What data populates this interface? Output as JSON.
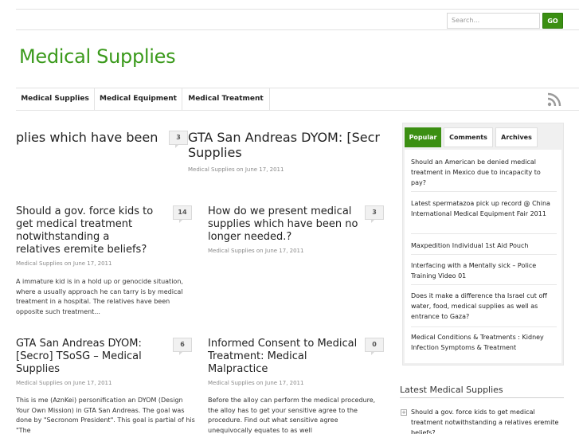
{
  "header": {
    "search_placeholder": "Search...",
    "go_label": "GO",
    "site_title": "Medical Supplies"
  },
  "nav": {
    "items": [
      "Medical Supplies",
      "Medical Equipment",
      "Medical Treatment"
    ],
    "rss_icon": "rss-icon"
  },
  "featured": {
    "left_title": "plies which have been",
    "right_title_line1": "GTA San Andreas DYOM: [Secr",
    "right_title_line2": "Supplies",
    "right_comments": "3",
    "right_meta": "Medical Supplies on June 17, 2011"
  },
  "posts": [
    {
      "title": "Should a gov. force kids to get medical treatment notwithstanding a relatives eremite beliefs?",
      "comments": "14",
      "meta": "Medical Supplies on June 17, 2011",
      "excerpt": "A immature kid is in a hold up or genocide situation, where a usually approach he can tarry is by medical treatment in a hospital. The relatives have been opposite such treatment..."
    },
    {
      "title": "How do we present medical supplies which have been no longer needed.?",
      "comments": "3",
      "meta": "Medical Supplies on June 17, 2011",
      "excerpt": ""
    },
    {
      "title": "GTA San Andreas DYOM: [Secro] TSoSG – Medical Supplies",
      "comments": "6",
      "meta": "Medical Supplies on June 17, 2011",
      "excerpt": "This is me (AznKei) personification an DYOM (Design Your Own Mission) in GTA San Andreas. The goal was done by \"Secronom President\". This goal is partial of his \"The"
    },
    {
      "title": "Informed Consent to Medical Treatment: Medical Malpractice",
      "comments": "0",
      "meta": "Medical Supplies on June 17, 2011",
      "excerpt": "Before the alloy can perform the medical procedure, the alloy has to get your sensitive agree to the procedure. Find out what sensitive agree unequivocally equates to as well"
    }
  ],
  "sidebar": {
    "tabs": [
      "Popular",
      "Comments",
      "Archives"
    ],
    "items": [
      "Should an American be denied medical treatment in Mexico due to incapacity to pay?",
      "Latest spermatazoa pick up record @ China International Medical Equipment Fair 2011",
      "Maxpedition Individual 1st Aid Pouch",
      "Interfacing with a Mentally sick – Police Training Video 01",
      "Does it make a difference tha Israel cut off water, food, medical supplies as well as entrance to Gaza?",
      "Medical Conditions & Treatments : Kidney Infection Symptoms & Treatment"
    ],
    "latest_title": "Latest Medical Supplies",
    "latest_item": "Should a gov. force kids to get medical treatment notwithstanding a relatives eremite beliefs?"
  },
  "colors": {
    "accent": "#3b8f12",
    "title_green": "#3b9a1c"
  }
}
